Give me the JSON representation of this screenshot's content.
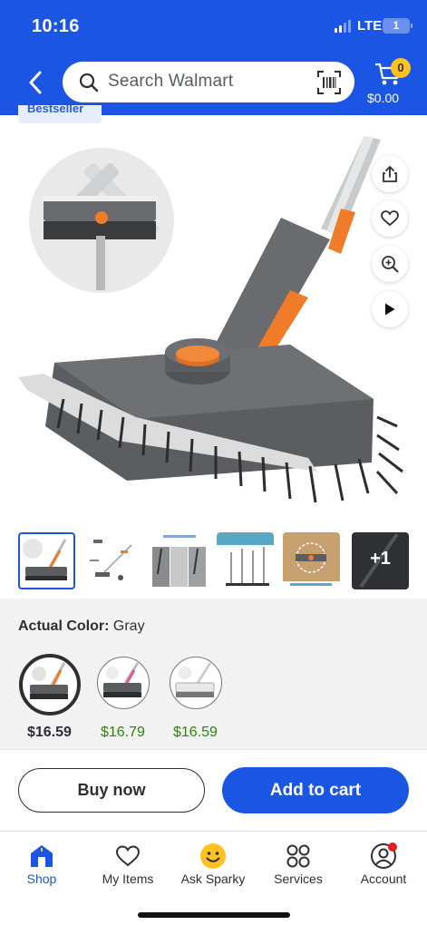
{
  "status_bar": {
    "time": "10:16",
    "network": "LTE",
    "battery": "1"
  },
  "header": {
    "search_placeholder": "Search Walmart",
    "cart_count": "0",
    "cart_total": "$0.00",
    "icons": [
      "back-icon",
      "search-icon",
      "barcode-scan-icon",
      "cart-icon"
    ]
  },
  "badge": {
    "label": "Bestseller"
  },
  "product": {
    "image_actions": [
      "share-icon",
      "heart-icon",
      "zoom-icon",
      "play-icon"
    ],
    "thumbnails_more": "+1"
  },
  "options": {
    "color_label": "Actual Color:",
    "color_value": "Gray",
    "variants": [
      {
        "price": "$16.59",
        "selected": true
      },
      {
        "price": "$16.79",
        "selected": false
      },
      {
        "price": "$16.59",
        "selected": false
      }
    ]
  },
  "actions": {
    "buy_now": "Buy now",
    "add_to_cart": "Add to cart"
  },
  "tabbar": {
    "items": [
      {
        "label": "Shop",
        "icon": "shop-icon",
        "active": true
      },
      {
        "label": "My Items",
        "icon": "heart-icon",
        "active": false
      },
      {
        "label": "Ask Sparky",
        "icon": "sparky-icon",
        "active": false
      },
      {
        "label": "Services",
        "icon": "services-grid-icon",
        "active": false
      },
      {
        "label": "Account",
        "icon": "account-icon",
        "active": false
      }
    ]
  },
  "colors": {
    "brand_blue": "#1a55e3",
    "cart_badge": "#ffc220",
    "price_green": "#2a8703",
    "product_orange": "#f07c2a",
    "product_gray": "#5c5d60",
    "notification_red": "#e02020"
  }
}
